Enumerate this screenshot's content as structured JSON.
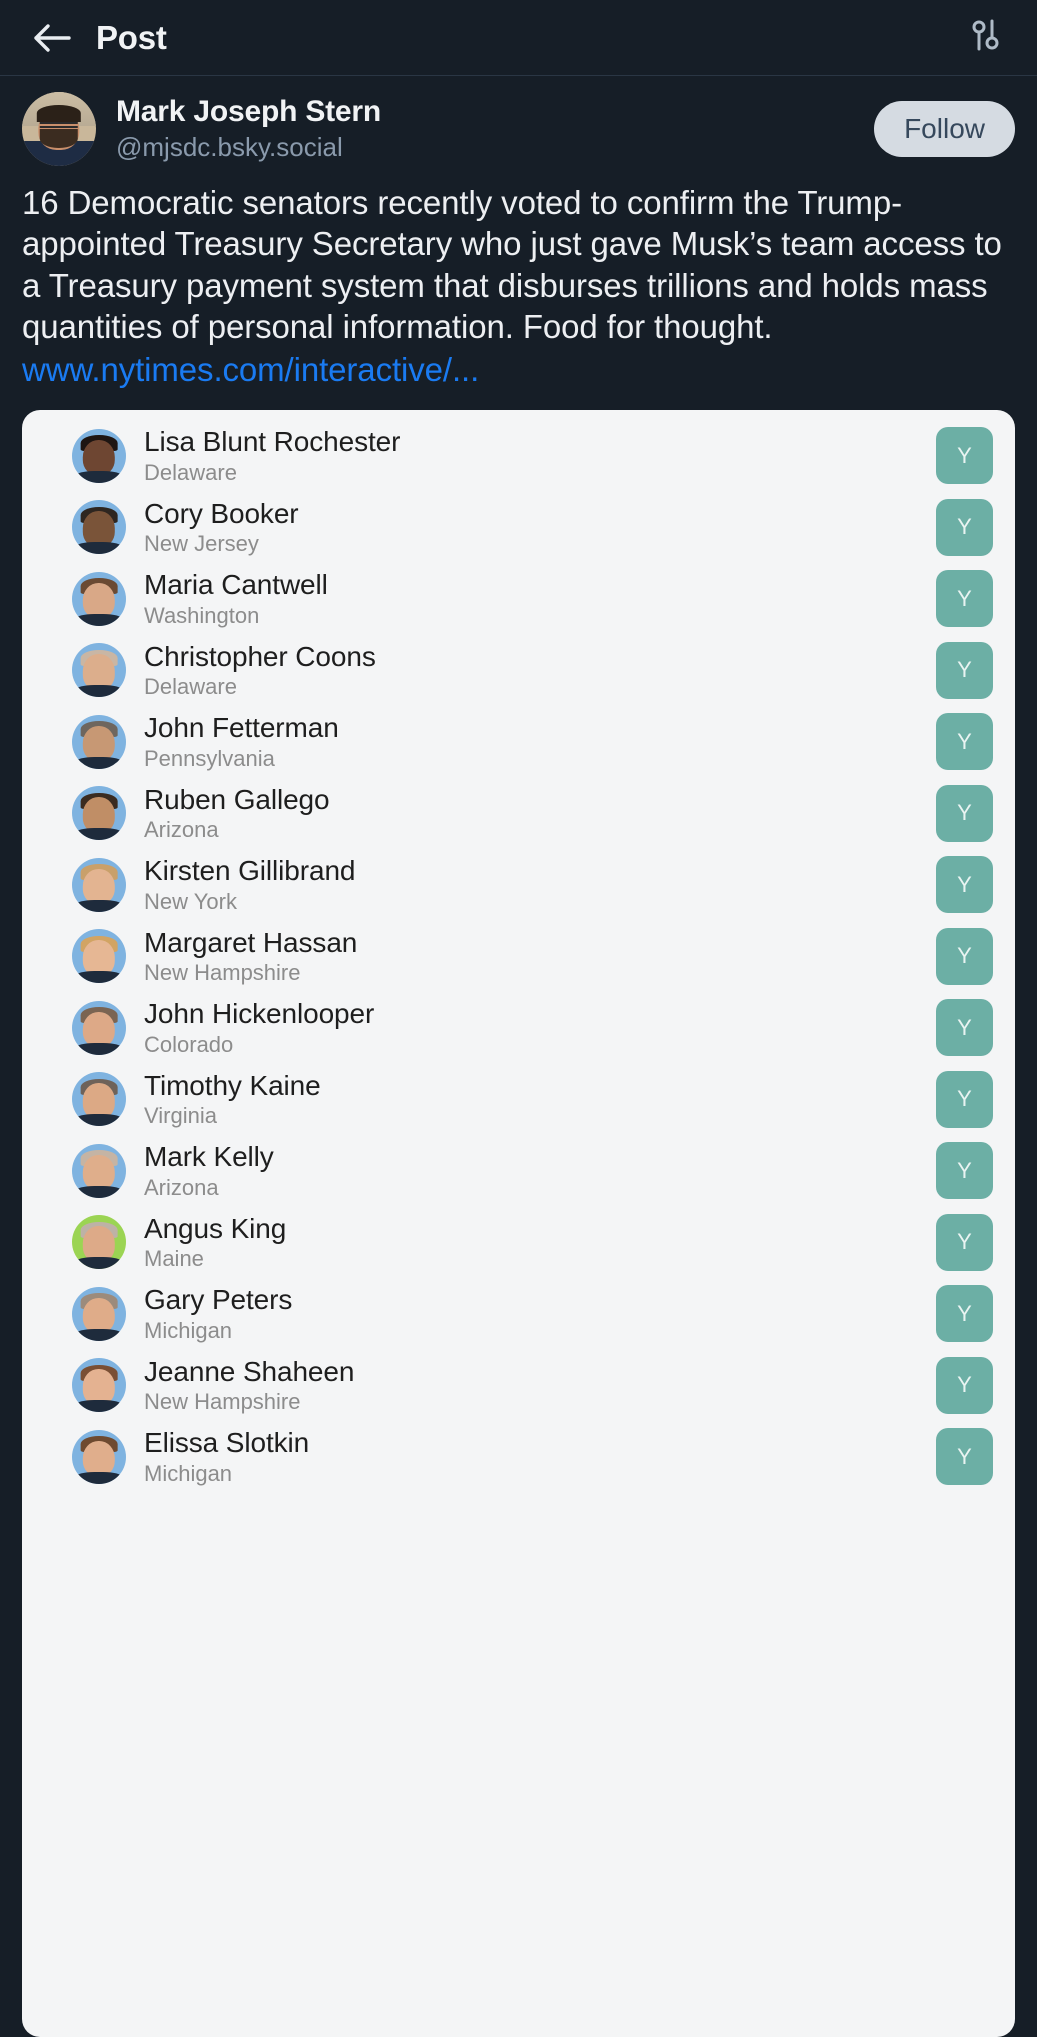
{
  "header": {
    "back_icon": "back-arrow-icon",
    "title": "Post",
    "settings_icon": "sliders-icon"
  },
  "author": {
    "display_name": "Mark Joseph Stern",
    "handle": "@mjsdc.bsky.social",
    "follow_label": "Follow",
    "avatar_alt": "Mark Joseph Stern profile photo"
  },
  "post": {
    "text": "16 Democratic senators recently voted to confirm the Trump-appointed Treasury Secretary who just gave Musk’s team access to a Treasury payment system that disburses trillions and holds mass quantities of personal information. Food for thought.",
    "link_text": "www.nytimes.com/interactive/..."
  },
  "colors": {
    "page_background": "#161E27",
    "card_background": "#F4F5F6",
    "link": "#1A7BF2",
    "follow_button_bg": "#D5DBE2",
    "follow_button_text": "#36485C",
    "vote_yes_badge": "#6CAFA5",
    "democrat_ring": "#7FB3E0",
    "independent_ring": "#9BD453"
  },
  "embed": {
    "vote_yes_label": "Y",
    "senators": [
      {
        "name": "Lisa Blunt Rochester",
        "state": "Delaware",
        "vote": "Y",
        "ring": "#7FB3E0",
        "skin": "#6E4632",
        "hair": "#1E1512"
      },
      {
        "name": "Cory Booker",
        "state": "New Jersey",
        "vote": "Y",
        "ring": "#7FB3E0",
        "skin": "#7A5439",
        "hair": "#2E2620"
      },
      {
        "name": "Maria Cantwell",
        "state": "Washington",
        "vote": "Y",
        "ring": "#7FB3E0",
        "skin": "#D9A887",
        "hair": "#6A4A33"
      },
      {
        "name": "Christopher Coons",
        "state": "Delaware",
        "vote": "Y",
        "ring": "#7FB3E0",
        "skin": "#DCAE8C",
        "hair": "#C9B6A4"
      },
      {
        "name": "John Fetterman",
        "state": "Pennsylvania",
        "vote": "Y",
        "ring": "#7FB3E0",
        "skin": "#C79874",
        "hair": "#6E665E"
      },
      {
        "name": "Ruben Gallego",
        "state": "Arizona",
        "vote": "Y",
        "ring": "#7FB3E0",
        "skin": "#C08E66",
        "hair": "#3A2B20"
      },
      {
        "name": "Kirsten Gillibrand",
        "state": "New York",
        "vote": "Y",
        "ring": "#7FB3E0",
        "skin": "#E3B491",
        "hair": "#C9A06A"
      },
      {
        "name": "Margaret Hassan",
        "state": "New Hampshire",
        "vote": "Y",
        "ring": "#7FB3E0",
        "skin": "#E6B794",
        "hair": "#D2A463"
      },
      {
        "name": "John Hickenlooper",
        "state": "Colorado",
        "vote": "Y",
        "ring": "#7FB3E0",
        "skin": "#DDA987",
        "hair": "#7A6452"
      },
      {
        "name": "Timothy Kaine",
        "state": "Virginia",
        "vote": "Y",
        "ring": "#7FB3E0",
        "skin": "#DCA985",
        "hair": "#6E6259"
      },
      {
        "name": "Mark Kelly",
        "state": "Arizona",
        "vote": "Y",
        "ring": "#7FB3E0",
        "skin": "#DFAE8B",
        "hair": "#C5B4A4"
      },
      {
        "name": "Angus King",
        "state": "Maine",
        "vote": "Y",
        "ring": "#9BD453",
        "skin": "#DDAA88",
        "hair": "#BDB2A6"
      },
      {
        "name": "Gary Peters",
        "state": "Michigan",
        "vote": "Y",
        "ring": "#7FB3E0",
        "skin": "#DFAC89",
        "hair": "#9C8B7C"
      },
      {
        "name": "Jeanne Shaheen",
        "state": "New Hampshire",
        "vote": "Y",
        "ring": "#7FB3E0",
        "skin": "#E4B291",
        "hair": "#7A4F34"
      },
      {
        "name": "Elissa Slotkin",
        "state": "Michigan",
        "vote": "Y",
        "ring": "#7FB3E0",
        "skin": "#E0AE8C",
        "hair": "#6E4A30"
      }
    ]
  }
}
